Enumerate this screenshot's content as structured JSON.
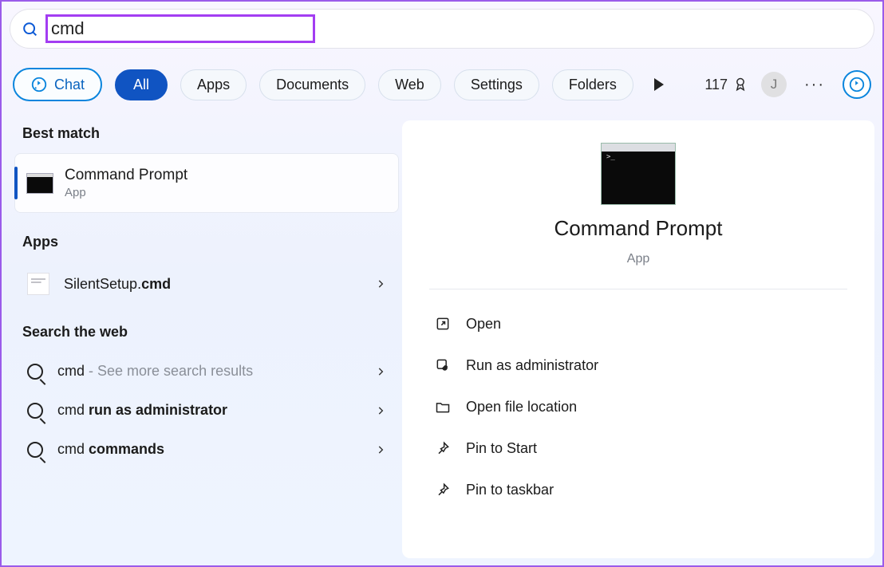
{
  "search": {
    "query": "cmd"
  },
  "filters": {
    "chat": "Chat",
    "tabs": [
      "All",
      "Apps",
      "Documents",
      "Web",
      "Settings",
      "Folders"
    ],
    "active_index": 0,
    "points": "117",
    "avatar_letter": "J"
  },
  "left": {
    "best_match_label": "Best match",
    "best": {
      "title": "Command Prompt",
      "subtitle": "App"
    },
    "apps_label": "Apps",
    "apps": [
      {
        "prefix": "SilentSetup.",
        "bold": "cmd"
      }
    ],
    "web_label": "Search the web",
    "web": [
      {
        "prefix": "cmd",
        "suffix": " - See more search results",
        "muted_suffix": true
      },
      {
        "prefix": "cmd ",
        "bold": "run as administrator"
      },
      {
        "prefix": "cmd ",
        "bold": "commands"
      }
    ]
  },
  "right": {
    "title": "Command Prompt",
    "subtitle": "App",
    "actions": [
      {
        "icon": "open",
        "label": "Open"
      },
      {
        "icon": "admin",
        "label": "Run as administrator"
      },
      {
        "icon": "folder",
        "label": "Open file location"
      },
      {
        "icon": "pin-start",
        "label": "Pin to Start"
      },
      {
        "icon": "pin-taskbar",
        "label": "Pin to taskbar"
      }
    ]
  }
}
